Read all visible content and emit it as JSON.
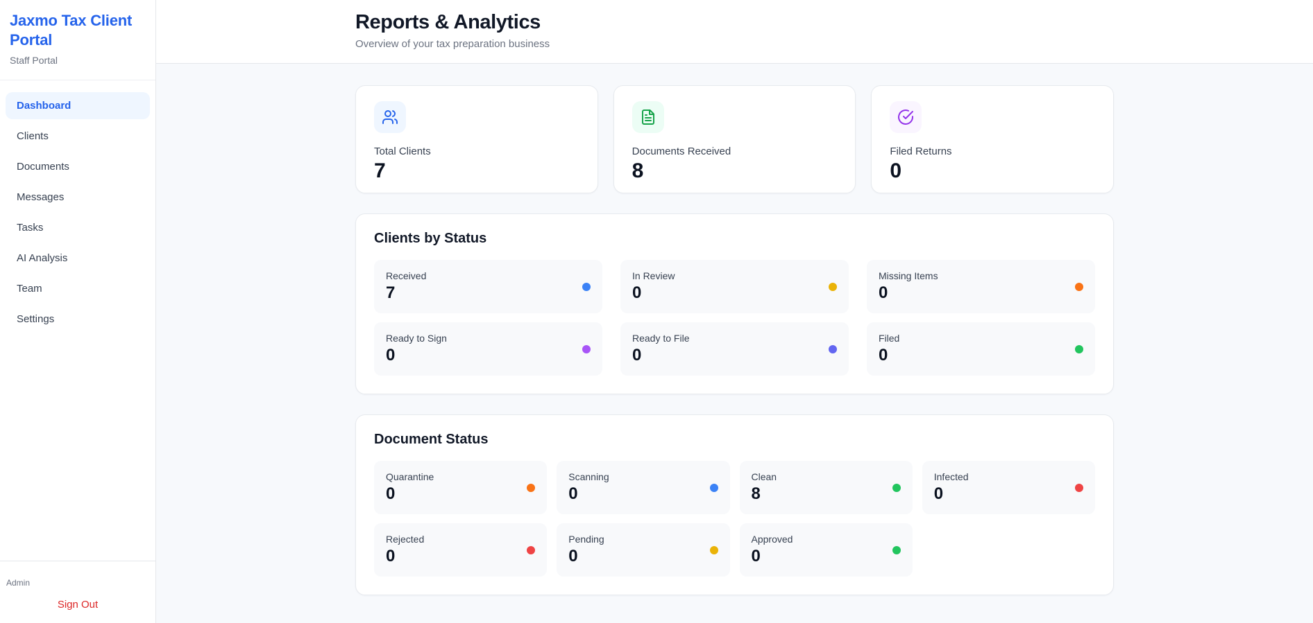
{
  "sidebar": {
    "brand": {
      "title": "Jaxmo Tax Client Portal",
      "subtitle": "Staff Portal"
    },
    "nav": [
      {
        "label": "Dashboard",
        "active": true
      },
      {
        "label": "Clients",
        "active": false
      },
      {
        "label": "Documents",
        "active": false
      },
      {
        "label": "Messages",
        "active": false
      },
      {
        "label": "Tasks",
        "active": false
      },
      {
        "label": "AI Analysis",
        "active": false
      },
      {
        "label": "Team",
        "active": false
      },
      {
        "label": "Settings",
        "active": false
      }
    ],
    "footer": {
      "user": "Admin",
      "signout_label": "Sign Out",
      "signout_color": "#dc2626"
    }
  },
  "header": {
    "title": "Reports & Analytics",
    "subtitle": "Overview of your tax preparation business"
  },
  "stats": [
    {
      "label": "Total Clients",
      "value": "7",
      "icon": "users-icon",
      "icon_color": "#2563eb",
      "icon_bg": "#eff6ff"
    },
    {
      "label": "Documents Received",
      "value": "8",
      "icon": "file-text-icon",
      "icon_color": "#16a34a",
      "icon_bg": "#ecfdf5"
    },
    {
      "label": "Filed Returns",
      "value": "0",
      "icon": "check-circle-icon",
      "icon_color": "#9333ea",
      "icon_bg": "#faf5ff"
    }
  ],
  "sections": [
    {
      "title": "Clients by Status",
      "columns": 3,
      "items": [
        {
          "label": "Received",
          "value": "7",
          "color": "#3b82f6"
        },
        {
          "label": "In Review",
          "value": "0",
          "color": "#eab308"
        },
        {
          "label": "Missing Items",
          "value": "0",
          "color": "#f97316"
        },
        {
          "label": "Ready to Sign",
          "value": "0",
          "color": "#a855f7"
        },
        {
          "label": "Ready to File",
          "value": "0",
          "color": "#6366f1"
        },
        {
          "label": "Filed",
          "value": "0",
          "color": "#22c55e"
        }
      ]
    },
    {
      "title": "Document Status",
      "columns": 4,
      "items": [
        {
          "label": "Quarantine",
          "value": "0",
          "color": "#f97316"
        },
        {
          "label": "Scanning",
          "value": "0",
          "color": "#3b82f6"
        },
        {
          "label": "Clean",
          "value": "8",
          "color": "#22c55e"
        },
        {
          "label": "Infected",
          "value": "0",
          "color": "#ef4444"
        },
        {
          "label": "Rejected",
          "value": "0",
          "color": "#ef4444"
        },
        {
          "label": "Pending",
          "value": "0",
          "color": "#eab308"
        },
        {
          "label": "Approved",
          "value": "0",
          "color": "#22c55e"
        }
      ]
    }
  ]
}
